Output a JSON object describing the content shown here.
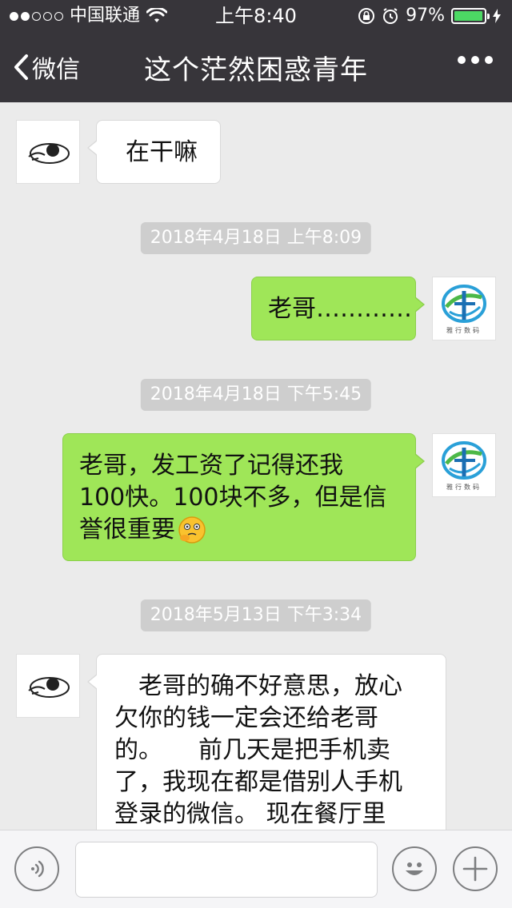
{
  "status": {
    "carrier": "中国联通",
    "time": "上午8:40",
    "battery": "97%",
    "battery_level": 0.97
  },
  "nav": {
    "back_label": "微信",
    "title": "这个茫然困惑青年"
  },
  "messages": [
    {
      "from": "other",
      "text": "在干嘛"
    },
    {
      "type": "time",
      "text": "2018年4月18日 上午8:09"
    },
    {
      "from": "me",
      "text": "老哥…………"
    },
    {
      "type": "time",
      "text": "2018年4月18日 下午5:45"
    },
    {
      "from": "me",
      "lines": [
        "老哥，发工资了记得还我",
        "100快。100块不多，但是信",
        "誉很重要"
      ]
    },
    {
      "type": "time",
      "text": "2018年5月13日 下午3:34"
    },
    {
      "from": "other",
      "lines": [
        "　老哥的确不好意思，放心",
        "欠你的钱一定会还给老哥",
        "的。　　前几天是把手机卖",
        "了，我现在都是借别人手机",
        "登录的微信。 现在餐厅里"
      ]
    }
  ],
  "my_avatar": {
    "logo_text": "雅行数码"
  },
  "input": {
    "value": ""
  },
  "colors": {
    "nav_bg": "#37353a",
    "chat_bg": "#ebebeb",
    "my_bubble": "#9fe658",
    "other_bubble": "#ffffff",
    "timestamp_bg": "#cecece"
  },
  "icons": [
    "signal-dots-icon",
    "wifi-icon",
    "orientation-lock-icon",
    "alarm-icon",
    "battery-icon",
    "back-chevron-icon",
    "more-dots-icon",
    "voice-icon",
    "emoji-icon",
    "plus-icon",
    "thinking-emoji-icon"
  ]
}
